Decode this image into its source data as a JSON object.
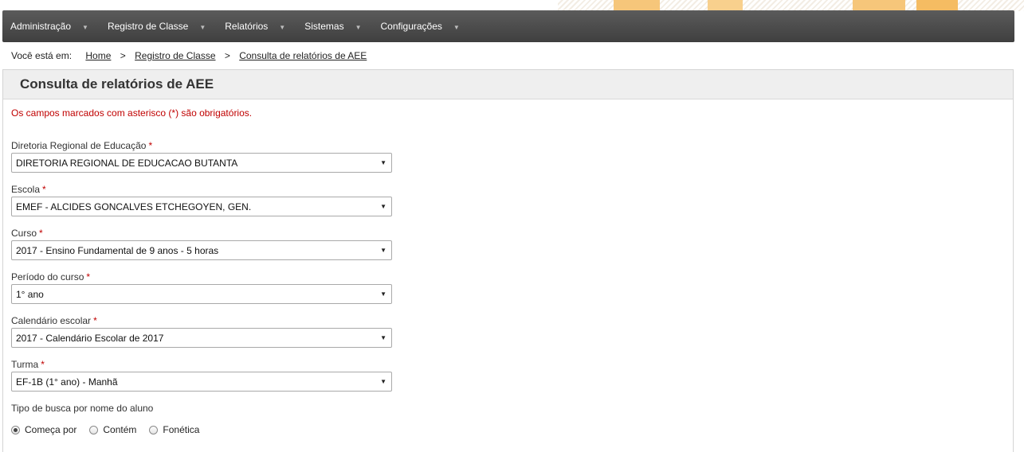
{
  "nav": {
    "items": [
      {
        "label": "Administração"
      },
      {
        "label": "Registro de Classe"
      },
      {
        "label": "Relatórios"
      },
      {
        "label": "Sistemas"
      },
      {
        "label": "Configurações"
      }
    ],
    "caret_glyph": "▼"
  },
  "breadcrumb": {
    "prefix": "Você está em:",
    "items": [
      "Home",
      "Registro de Classe",
      "Consulta de relatórios de AEE"
    ],
    "separator": ">"
  },
  "page": {
    "title": "Consulta de relatórios de AEE",
    "required_note": "Os campos marcados com asterisco (*) são obrigatórios.",
    "required_mark": "*"
  },
  "form": {
    "fields": [
      {
        "label": "Diretoria Regional de Educação",
        "value": "DIRETORIA REGIONAL DE EDUCACAO BUTANTA"
      },
      {
        "label": "Escola",
        "value": "EMEF - ALCIDES GONCALVES ETCHEGOYEN, GEN."
      },
      {
        "label": "Curso",
        "value": "2017 - Ensino Fundamental de 9 anos - 5 horas"
      },
      {
        "label": "Período do curso",
        "value": "1° ano"
      },
      {
        "label": "Calendário escolar",
        "value": "2017 - Calendário Escolar de 2017"
      },
      {
        "label": "Turma",
        "value": "EF-1B (1° ano) - Manhã"
      }
    ],
    "search_type": {
      "label": "Tipo de busca por nome do aluno",
      "options": [
        {
          "label": "Começa por",
          "selected": true
        },
        {
          "label": "Contém",
          "selected": false
        },
        {
          "label": "Fonética",
          "selected": false
        }
      ]
    }
  },
  "colors": {
    "navbar": "#4a4a4a",
    "required": "#c00000",
    "accent_orange": "#f6c67a"
  }
}
